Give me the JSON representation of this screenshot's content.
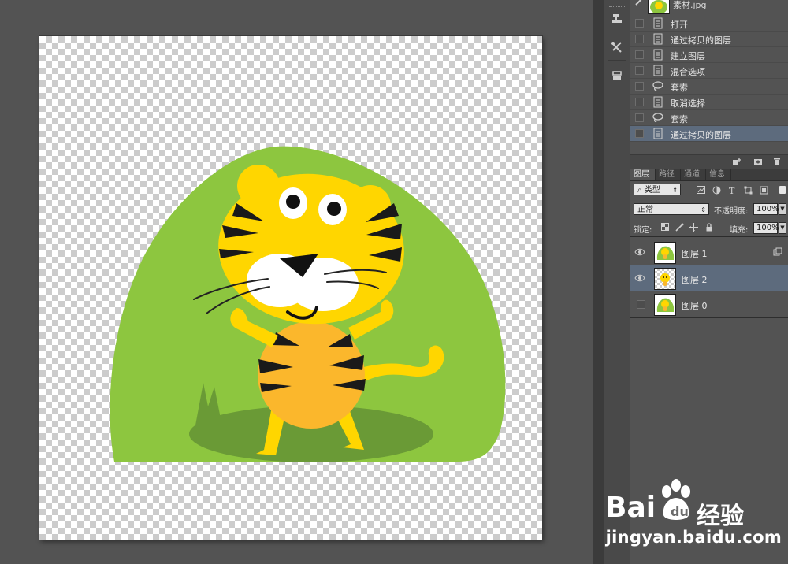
{
  "history": {
    "snapshot_label": "素材.jpg",
    "items": [
      {
        "label": "打开",
        "icon": "document-icon",
        "selected": false
      },
      {
        "label": "通过拷贝的图层",
        "icon": "document-icon",
        "selected": false
      },
      {
        "label": "建立图层",
        "icon": "document-icon",
        "selected": false
      },
      {
        "label": "混合选项",
        "icon": "document-icon",
        "selected": false
      },
      {
        "label": "套索",
        "icon": "lasso-icon",
        "selected": false
      },
      {
        "label": "取消选择",
        "icon": "document-icon",
        "selected": false
      },
      {
        "label": "套索",
        "icon": "lasso-icon",
        "selected": false
      },
      {
        "label": "通过拷贝的图层",
        "icon": "document-icon",
        "selected": true
      }
    ]
  },
  "layers_panel": {
    "tabs": [
      "图层",
      "路径",
      "通道",
      "信息"
    ],
    "active_tab": "图层",
    "filter_label": "类型",
    "blend_mode": "正常",
    "opacity_label": "不透明度:",
    "opacity_value": "100%",
    "lock_label": "锁定:",
    "fill_label": "填充:",
    "fill_value": "100%",
    "layers": [
      {
        "name": "图层 1",
        "visible": true,
        "selected": false,
        "thumb": "artwork",
        "linked": true
      },
      {
        "name": "图层 2",
        "visible": true,
        "selected": true,
        "thumb": "transparent-tiger",
        "linked": false
      },
      {
        "name": "图层 0",
        "visible": false,
        "selected": false,
        "thumb": "artwork",
        "linked": false
      }
    ]
  },
  "watermark": {
    "logo_text": "Bai",
    "logo_text_2": "经验",
    "url": "jingyan.baidu.com"
  },
  "colors": {
    "workspace": "#535353",
    "panel": "#535353",
    "selected_row": "#5d6b7d",
    "artwork_green": "#8dc63f",
    "tiger_yellow": "#ffd600",
    "tiger_orange": "#fbb72c"
  }
}
